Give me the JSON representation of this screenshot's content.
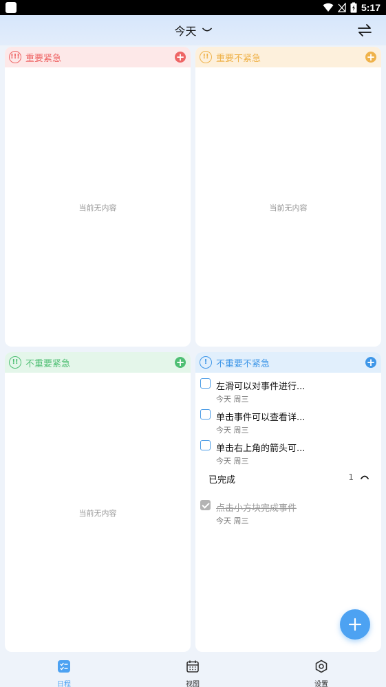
{
  "status_bar": {
    "time": "5:17"
  },
  "header": {
    "title": "今天"
  },
  "quadrants": [
    {
      "title": "重要紧急",
      "icon": "!!!",
      "color": "#ee6565",
      "head_bg": "#fde8e8",
      "empty": "当前无内容"
    },
    {
      "title": "重要不紧急",
      "icon": "!!",
      "color": "#efb24a",
      "head_bg": "#fdf0dc",
      "empty": "当前无内容"
    },
    {
      "title": "不重要紧急",
      "icon": "!!",
      "color": "#4fbf74",
      "head_bg": "#e4f6ea",
      "empty": "当前无内容"
    },
    {
      "title": "不重要不紧急",
      "icon": "!",
      "color": "#3f97e8",
      "head_bg": "#e1effc"
    }
  ],
  "tasks": [
    {
      "title": "左滑可以对事件进行...",
      "date": "今天 周三"
    },
    {
      "title": "单击事件可以查看详...",
      "date": "今天 周三"
    },
    {
      "title": "单击右上角的箭头可...",
      "date": "今天 周三"
    }
  ],
  "completed": {
    "label": "已完成",
    "count": "1",
    "items": [
      {
        "title": "点击小方块完成事件",
        "date": "今天 周三"
      }
    ]
  },
  "nav": [
    {
      "label": "日程",
      "icon": "schedule-icon",
      "active": true
    },
    {
      "label": "视图",
      "icon": "calendar-icon",
      "active": false
    },
    {
      "label": "设置",
      "icon": "settings-icon",
      "active": false
    }
  ],
  "colors": {
    "accent": "#4da2f2",
    "nav_inactive": "#333333"
  }
}
